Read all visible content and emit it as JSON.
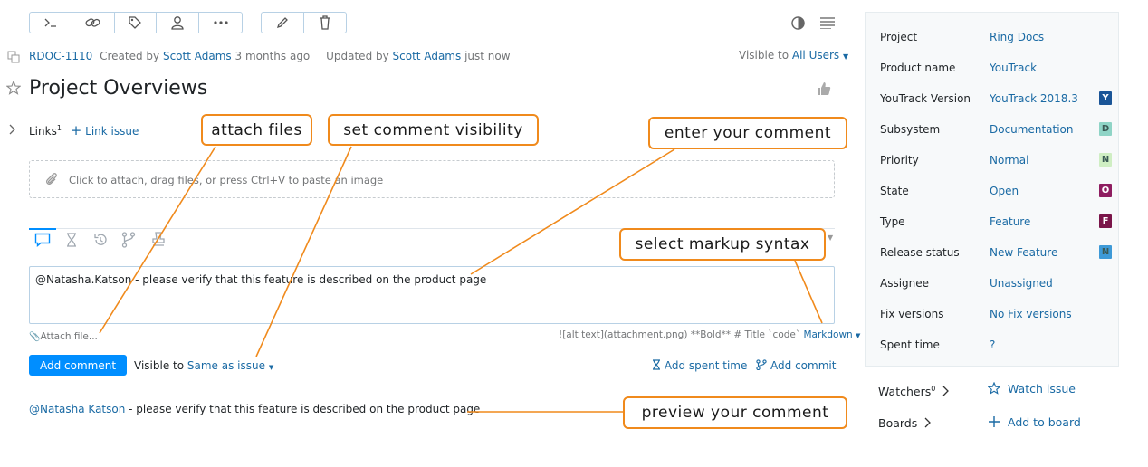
{
  "issue": {
    "id": "RDOC-1110",
    "created_prefix": "Created by",
    "creator": "Scott Adams",
    "created_time": "3 months ago",
    "updated_prefix": "Updated by",
    "updater": "Scott Adams",
    "updated_time": "just now",
    "visible_prefix": "Visible to",
    "visible_value": "All Users",
    "title": "Project Overviews"
  },
  "links": {
    "label": "Links",
    "count": "1",
    "add_label": "Link issue"
  },
  "attach_zone": {
    "text": "Click to attach, drag files, or press Ctrl+V to paste an image"
  },
  "comment": {
    "text": "@Natasha.Katson - please verify that this feature is described on the product page",
    "attach_link": "Attach file...",
    "markup_hint": "![alt text](attachment.png) **Bold** # Title `code`",
    "markup_value": "Markdown",
    "submit_label": "Add comment",
    "visible_prefix": "Visible to",
    "visible_value": "Same as issue",
    "spent_time_label": "Add spent time",
    "commit_label": "Add commit"
  },
  "preview": {
    "mention": "@Natasha Katson",
    "text": " - please verify that this feature is described on the product page"
  },
  "sidebar": {
    "fields": [
      {
        "label": "Project",
        "value": "Ring Docs",
        "badge": "",
        "badge_color": ""
      },
      {
        "label": "Product name",
        "value": "YouTrack",
        "badge": "",
        "badge_color": ""
      },
      {
        "label": "YouTrack Version",
        "value": "YouTrack 2018.3",
        "badge": "Y",
        "badge_color": "#1a5597"
      },
      {
        "label": "Subsystem",
        "value": "Documentation",
        "badge": "D",
        "badge_color": "#8fd4c6"
      },
      {
        "label": "Priority",
        "value": "Normal",
        "badge": "N",
        "badge_color": "#cfeec3"
      },
      {
        "label": "State",
        "value": "Open",
        "badge": "O",
        "badge_color": "#8e1d60"
      },
      {
        "label": "Type",
        "value": "Feature",
        "badge": "F",
        "badge_color": "#7a1549"
      },
      {
        "label": "Release status",
        "value": "New Feature",
        "badge": "N",
        "badge_color": "#3e9ad7"
      },
      {
        "label": "Assignee",
        "value": "Unassigned",
        "badge": "",
        "badge_color": ""
      },
      {
        "label": "Fix versions",
        "value": "No Fix versions",
        "badge": "",
        "badge_color": ""
      },
      {
        "label": "Spent time",
        "value": "?",
        "badge": "",
        "badge_color": ""
      }
    ],
    "watchers_label": "Watchers",
    "watchers_count": "0",
    "watch_label": "Watch issue",
    "boards_label": "Boards",
    "add_board_label": "Add to board"
  },
  "callouts": {
    "attach": "attach files",
    "visibility": "set comment visibility",
    "enter": "enter your comment",
    "markup": "select markup syntax",
    "preview": "preview your comment"
  },
  "colors": {
    "accent": "#008eff",
    "link": "#1a6aa4",
    "callout_border": "#f08a1c"
  }
}
